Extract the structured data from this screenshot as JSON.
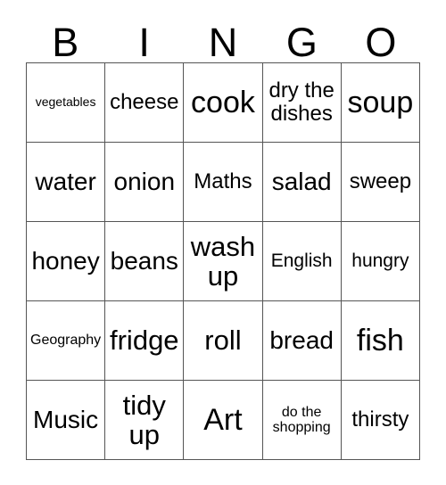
{
  "card": {
    "header_letters": [
      "B",
      "I",
      "N",
      "G",
      "O"
    ],
    "rows": [
      [
        {
          "text": "vegetables",
          "size": "fs-xs"
        },
        {
          "text": "cheese",
          "size": "fs-m"
        },
        {
          "text": "cook",
          "size": "fs-xxl"
        },
        {
          "text": "dry the dishes",
          "size": "fs-m"
        },
        {
          "text": "soup",
          "size": "fs-xxl"
        }
      ],
      [
        {
          "text": "water",
          "size": "fs-l"
        },
        {
          "text": "onion",
          "size": "fs-l"
        },
        {
          "text": "Maths",
          "size": "fs-m"
        },
        {
          "text": "salad",
          "size": "fs-l"
        },
        {
          "text": "sweep",
          "size": "fs-m"
        }
      ],
      [
        {
          "text": "honey",
          "size": "fs-l"
        },
        {
          "text": "beans",
          "size": "fs-l"
        },
        {
          "text": "wash up",
          "size": "fs-xl"
        },
        {
          "text": "English",
          "size": "fs-sm"
        },
        {
          "text": "hungry",
          "size": "fs-sm"
        }
      ],
      [
        {
          "text": "Geography",
          "size": "fs-s"
        },
        {
          "text": "fridge",
          "size": "fs-xl"
        },
        {
          "text": "roll",
          "size": "fs-xl"
        },
        {
          "text": "bread",
          "size": "fs-l"
        },
        {
          "text": "fish",
          "size": "fs-xxl"
        }
      ],
      [
        {
          "text": "Music",
          "size": "fs-l"
        },
        {
          "text": "tidy up",
          "size": "fs-xl"
        },
        {
          "text": "Art",
          "size": "fs-xxl"
        },
        {
          "text": "do the shopping",
          "size": "fs-s"
        },
        {
          "text": "thirsty",
          "size": "fs-m"
        }
      ]
    ],
    "colors": {
      "border": "#555555",
      "text": "#000000",
      "background": "#ffffff"
    }
  }
}
